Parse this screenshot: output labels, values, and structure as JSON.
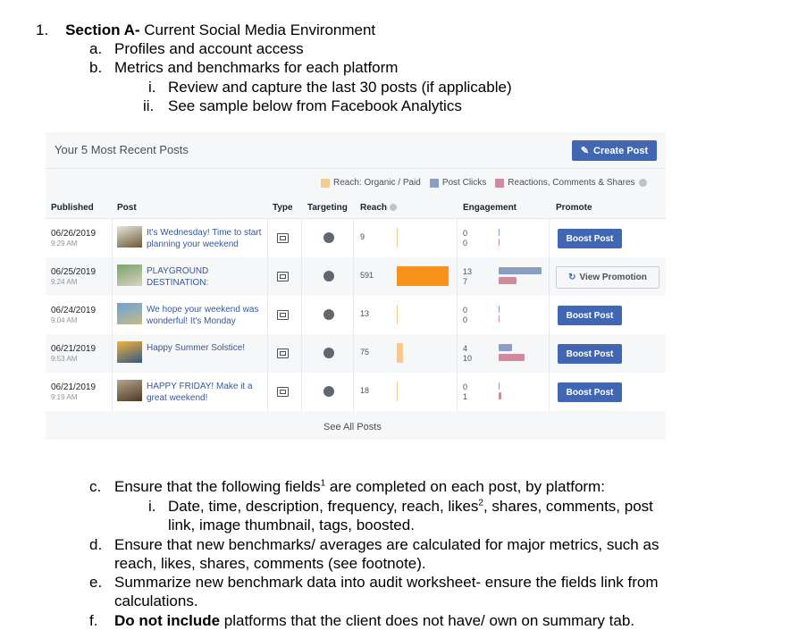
{
  "doc": {
    "l1_num": "1.",
    "l1_bold": "Section A-",
    "l1_rest": " Current Social Media Environment",
    "a_label": "a.",
    "a_text": "Profiles and account access",
    "b_label": "b.",
    "b_text": "Metrics and benchmarks for each platform",
    "bi_label": "i.",
    "bi_text": "Review and capture the last 30 posts (if applicable)",
    "bii_label": "ii.",
    "bii_text": "See sample below from Facebook Analytics",
    "c_label": "c.",
    "c_text1": "Ensure that the following fields",
    "c_sup": "1",
    "c_text2": " are completed on each post, by platform:",
    "ci_label": "i.",
    "ci_text1": "Date, time, description, frequency, reach, likes",
    "ci_sup": "2",
    "ci_text2": ", shares, comments, post",
    "ci_text3": "link, image thumbnail, tags, boosted.",
    "d_label": "d.",
    "d_text1": "Ensure that new benchmarks/ averages are calculated for major metrics, such as",
    "d_text2": "reach, likes, shares, comments (see footnote).",
    "e_label": "e.",
    "e_text1": "Summarize new benchmark data into audit worksheet- ensure the fields link from",
    "e_text2": "calculations.",
    "f_label": "f.",
    "f_bold": "Do not include",
    "f_rest": " platforms that the client does not have/ own on summary tab."
  },
  "fb": {
    "title": "Your 5 Most Recent Posts",
    "create_label": "Create Post",
    "legend": [
      "Reach: Organic / Paid",
      "Post Clicks",
      "Reactions, Comments & Shares"
    ],
    "headers": {
      "published": "Published",
      "post": "Post",
      "type": "Type",
      "targeting": "Targeting",
      "reach": "Reach",
      "engagement": "Engagement",
      "promote": "Promote"
    },
    "rows": [
      {
        "date": "06/26/2019",
        "time": "9:29 AM",
        "text": "It's Wednesday! Time to start planning your weekend",
        "reach": "9",
        "reach_value": 9,
        "clicks": "0",
        "reactions": "0",
        "clicks_value": 0,
        "reactions_value": 0,
        "action": "Boost Post"
      },
      {
        "date": "06/25/2019",
        "time": "9:24 AM",
        "text": "PLAYGROUND DESTINATION:",
        "reach": "591",
        "reach_value": 591,
        "clicks": "13",
        "reactions": "7",
        "clicks_value": 13,
        "reactions_value": 7,
        "action": "View Promotion"
      },
      {
        "date": "06/24/2019",
        "time": "9:04 AM",
        "text": "We hope your weekend was wonderful! It's Monday",
        "reach": "13",
        "reach_value": 13,
        "clicks": "0",
        "reactions": "0",
        "clicks_value": 0,
        "reactions_value": 0,
        "action": "Boost Post"
      },
      {
        "date": "06/21/2019",
        "time": "9:53 AM",
        "text": "Happy Summer Solstice!",
        "reach": "75",
        "reach_value": 75,
        "clicks": "4",
        "reactions": "10",
        "clicks_value": 4,
        "reactions_value": 10,
        "action": "Boost Post"
      },
      {
        "date": "06/21/2019",
        "time": "9:19 AM",
        "text": "HAPPY FRIDAY! Make it a great weekend!",
        "reach": "18",
        "reach_value": 18,
        "clicks": "0",
        "reactions": "1",
        "clicks_value": 0,
        "reactions_value": 1,
        "action": "Boost Post"
      }
    ],
    "see_all": "See All Posts"
  },
  "colors": {
    "reach": "#f7931d",
    "clicks": "#8b9dc3",
    "reactions": "#d08a9b",
    "fb_blue": "#4267b2"
  }
}
